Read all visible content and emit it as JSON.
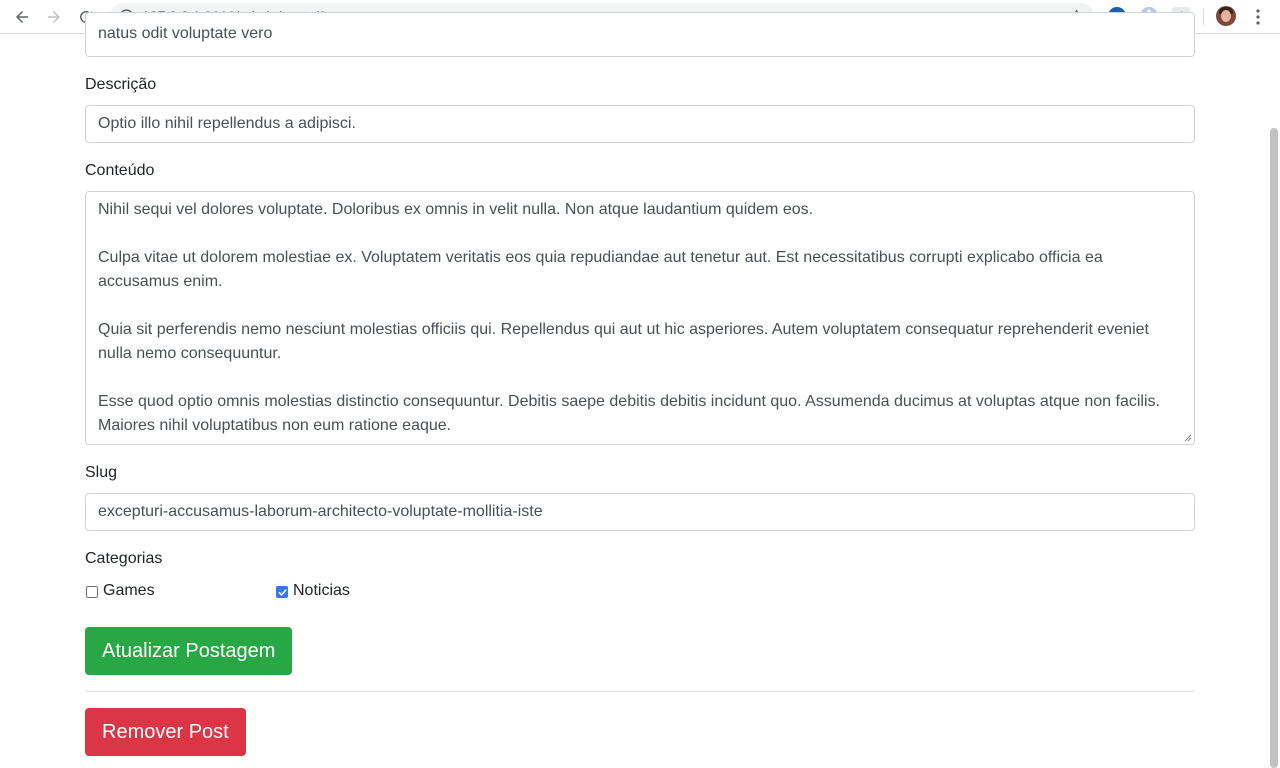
{
  "browser": {
    "url_host": "127.0.0.1",
    "url_path": ":8000/admin/posts/3"
  },
  "form": {
    "title_value": "natus odit voluptate vero",
    "description": {
      "label": "Descrição",
      "value": "Optio illo nihil repellendus a adipisci."
    },
    "content": {
      "label": "Conteúdo",
      "value": "Nihil sequi vel dolores voluptate. Doloribus ex omnis in velit nulla. Non atque laudantium quidem eos.\n\nCulpa vitae ut dolorem molestiae ex. Voluptatem veritatis eos quia repudiandae aut tenetur aut. Est necessitatibus corrupti explicabo officia ea accusamus enim.\n\nQuia sit perferendis nemo nesciunt molestias officiis qui. Repellendus qui aut ut hic asperiores. Autem voluptatem consequatur reprehenderit eveniet nulla nemo consequuntur.\n\nEsse quod optio omnis molestias distinctio consequuntur. Debitis saepe debitis debitis incidunt quo. Assumenda ducimus at voluptas atque non facilis. Maiores nihil voluptatibus non eum ratione eaque."
    },
    "slug": {
      "label": "Slug",
      "value": "excepturi-accusamus-laborum-architecto-voluptate-mollitia-iste"
    },
    "categories": {
      "label": "Categorias",
      "items": [
        {
          "label": "Games",
          "checked": false
        },
        {
          "label": "Noticias",
          "checked": true
        }
      ]
    },
    "update_button": "Atualizar Postagem",
    "remove_button": "Remover Post"
  },
  "colors": {
    "success": "#28a745",
    "danger": "#dc3545",
    "checkbox_checked": "#3478f6"
  }
}
